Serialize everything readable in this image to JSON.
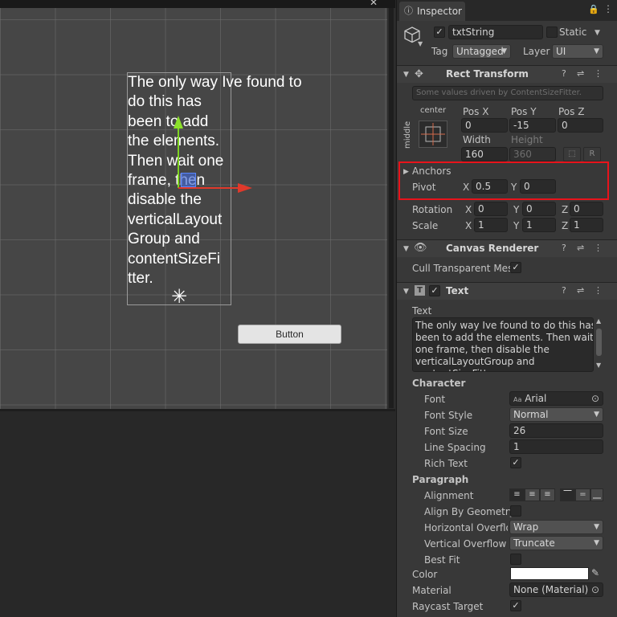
{
  "scene": {
    "text_lines": "The only way Ive found to\ndo this has\nbeen to add\nthe elements.\nThen wait one\nframe, then\ndisable the\nverticalLayout\nGroup and\ncontentSizeFi\ntter.",
    "button_label": "Button"
  },
  "inspector": {
    "tab_label": "Inspector",
    "object_name": "txtString",
    "static_label": "Static",
    "tag_label": "Tag",
    "tag_value": "Untagged",
    "layer_label": "Layer",
    "layer_value": "UI"
  },
  "rect_transform": {
    "title": "Rect Transform",
    "driven_note": "Some values driven by ContentSizeFitter.",
    "anchor_h": "center",
    "anchor_v": "middle",
    "pos_x_label": "Pos X",
    "pos_y_label": "Pos Y",
    "pos_z_label": "Pos Z",
    "pos_x": "0",
    "pos_y": "-15",
    "pos_z": "0",
    "width_label": "Width",
    "height_label": "Height",
    "width": "160",
    "height": "360",
    "raw_btn": "R",
    "anchors_label": "Anchors",
    "pivot_label": "Pivot",
    "pivot_x_label": "X",
    "pivot_x": "0.5",
    "pivot_y_label": "Y",
    "pivot_y": "0",
    "rotation_label": "Rotation",
    "scale_label": "Scale",
    "rot_x": "0",
    "rot_y": "0",
    "rot_z": "0",
    "scale_x": "1",
    "scale_y": "1",
    "scale_z": "1",
    "x": "X",
    "y": "Y",
    "z": "Z"
  },
  "canvas_renderer": {
    "title": "Canvas Renderer",
    "cull_label": "Cull Transparent Mes"
  },
  "text_component": {
    "title": "Text",
    "text_label": "Text",
    "text_value": "The only way Ive found to do this has\nbeen to add the elements. Then wait\none frame, then disable the\nverticalLayoutGroup and\ncontentSizeFitter.",
    "character_label": "Character",
    "font_label": "Font",
    "font_value": "Arial",
    "font_style_label": "Font Style",
    "font_style_value": "Normal",
    "font_size_label": "Font Size",
    "font_size_value": "26",
    "line_spacing_label": "Line Spacing",
    "line_spacing_value": "1",
    "rich_text_label": "Rich Text",
    "paragraph_label": "Paragraph",
    "alignment_label": "Alignment",
    "align_geom_label": "Align By Geometry",
    "h_overflow_label": "Horizontal Overflow",
    "h_overflow_value": "Wrap",
    "v_overflow_label": "Vertical Overflow",
    "v_overflow_value": "Truncate",
    "best_fit_label": "Best Fit",
    "color_label": "Color",
    "material_label": "Material",
    "material_value": "None (Material)",
    "raycast_label": "Raycast Target"
  },
  "icons": {
    "check": "✓",
    "caret": "▼",
    "fold_open": "▼",
    "fold_closed": "▶",
    "help": "?",
    "settings": "⇌",
    "more": "⋮",
    "lock": "🔒",
    "circle_target": "⊙",
    "eyedropper": "✎",
    "close": "✕",
    "pivot": "✳"
  },
  "colors": {
    "highlight": "#e8131b",
    "text_color_swatch": "#ffffff",
    "gizmo_x": "#e0392b",
    "gizmo_y": "#7ed321"
  }
}
